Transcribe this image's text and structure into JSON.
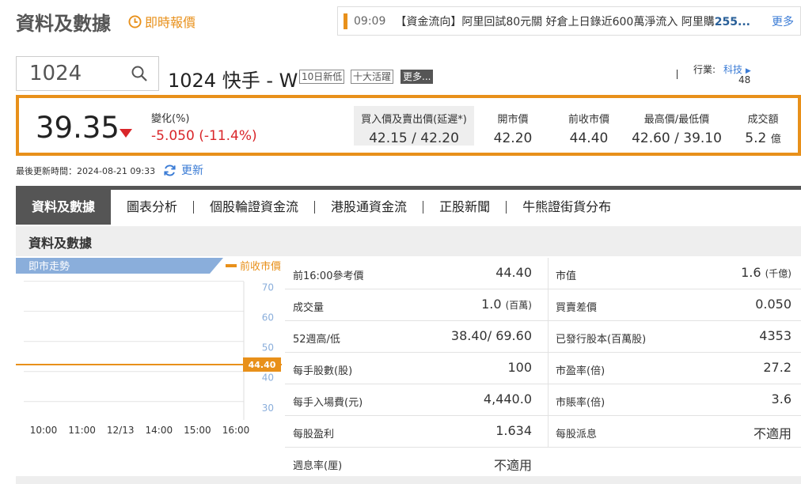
{
  "header": {
    "title": "資料及數據",
    "realtime_link": "即時報價"
  },
  "news_ticker": {
    "time": "09:09",
    "text": "【資金流向】阿里回試80元關 好倉上日錄近600萬淨流入 阿里購",
    "highlight": "255...",
    "more": "更多"
  },
  "search": {
    "value": "1024"
  },
  "stock": {
    "name": "1024 快手 - W",
    "tags": [
      "10日新低",
      "十大活躍",
      "更多..."
    ],
    "industry_label": "行業:",
    "industry_value": "科技",
    "industry_count": "48"
  },
  "quote": {
    "last_price": "39.35",
    "change_label": "變化(%)",
    "change_value": "-5.050 (-11.4%)",
    "bid_ask_label": "買入價及賣出價(延遲*)",
    "bid_ask_value": "42.15 / 42.20",
    "open_label": "開市價",
    "open_value": "42.20",
    "prev_close_label": "前收市價",
    "prev_close_value": "44.40",
    "high_low_label": "最高價/最低價",
    "high_low_value": "42.60 / 39.10",
    "turnover_label": "成交額",
    "turnover_value": "5.2",
    "turnover_unit": "億",
    "colors": {
      "down": "#d9262a",
      "accent": "#e8901a"
    }
  },
  "update": {
    "label": "最後更新時間：2024-08-21 09:33",
    "refresh": "更新"
  },
  "tabs": [
    "資料及數據",
    "圖表分析",
    "個股輪證資金流",
    "港股通資金流",
    "正股新聞",
    "牛熊證街貨分布"
  ],
  "section_title": "資料及數據",
  "chart_data": {
    "type": "line",
    "title": "即市走勢",
    "legend": "前收市價",
    "categories": [
      "10:00",
      "11:00",
      "12/13",
      "14:00",
      "15:00",
      "16:00"
    ],
    "yticks": [
      70,
      60,
      50,
      40,
      30
    ],
    "ylim": [
      26,
      72
    ],
    "reference_line": {
      "name": "前收市價",
      "value": 44.4,
      "label": "44.40"
    },
    "grid": true
  },
  "table": {
    "left": [
      {
        "label": "前16:00參考價",
        "value": "44.40",
        "unit": ""
      },
      {
        "label": "成交量",
        "value": "1.0",
        "unit": "(百萬)"
      },
      {
        "label": "52週高/低",
        "value": "38.40/ 69.60",
        "unit": ""
      },
      {
        "label": "每手股數(股)",
        "value": "100",
        "unit": ""
      },
      {
        "label": "每手入場費(元)",
        "value": "4,440.0",
        "unit": ""
      },
      {
        "label": "每股盈利",
        "value": "1.634",
        "unit": ""
      },
      {
        "label": "週息率(厘)",
        "value": "不適用",
        "unit": ""
      }
    ],
    "right": [
      {
        "label": "市值",
        "value": "1.6",
        "unit": "(千億)"
      },
      {
        "label": "買賣差價",
        "value": "0.050",
        "unit": ""
      },
      {
        "label": "已發行股本(百萬股)",
        "value": "4353",
        "unit": ""
      },
      {
        "label": "市盈率(倍)",
        "value": "27.2",
        "unit": ""
      },
      {
        "label": "市賬率(倍)",
        "value": "3.6",
        "unit": ""
      },
      {
        "label": "每股派息",
        "value": "不適用",
        "unit": ""
      }
    ]
  }
}
